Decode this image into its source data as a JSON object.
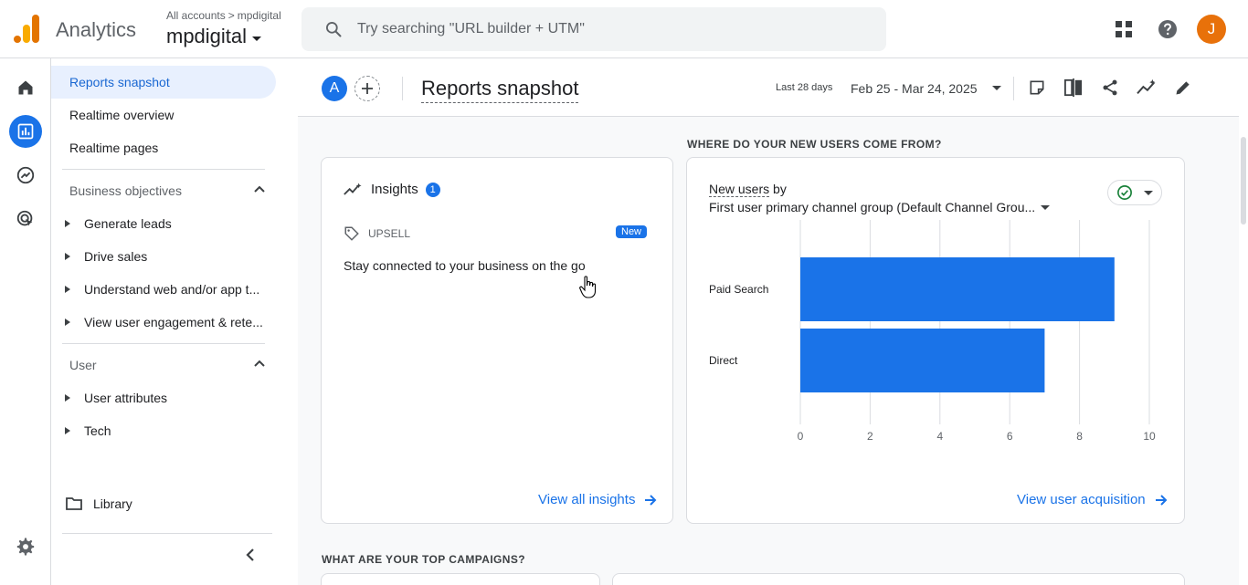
{
  "topbar": {
    "app_name": "Analytics",
    "breadcrumb_root": "All accounts",
    "breadcrumb_sep": ">",
    "breadcrumb_account": "mpdigital",
    "property_name": "mpdigital",
    "search_placeholder": "Try searching \"URL builder + UTM\"",
    "avatar_letter": "J",
    "colors": {
      "logo_dark": "#e37400",
      "logo_light": "#f9ab00",
      "avatar": "#e8710a"
    }
  },
  "rail": {
    "items": [
      {
        "icon": "home-icon",
        "active": false
      },
      {
        "icon": "reports-icon",
        "active": true
      },
      {
        "icon": "explore-icon",
        "active": false
      },
      {
        "icon": "advertising-icon",
        "active": false
      }
    ],
    "admin_icon": "gear-icon"
  },
  "nav": {
    "top_items": [
      {
        "label": "Reports snapshot",
        "active": true
      },
      {
        "label": "Realtime overview",
        "active": false
      },
      {
        "label": "Realtime pages",
        "active": false
      }
    ],
    "business_section": "Business objectives",
    "business_items": [
      {
        "label": "Generate leads"
      },
      {
        "label": "Drive sales"
      },
      {
        "label": "Understand web and/or app t..."
      },
      {
        "label": "View user engagement & rete..."
      }
    ],
    "user_section": "User",
    "user_items": [
      {
        "label": "User attributes"
      },
      {
        "label": "Tech"
      }
    ],
    "library_label": "Library"
  },
  "header": {
    "comparison_letter": "A",
    "title": "Reports snapshot",
    "date_label": "Last 28 days",
    "date_range": "Feb 25 - Mar 24, 2025",
    "icons": [
      "note-icon",
      "compare-icon",
      "share-icon",
      "insights-icon",
      "edit-icon"
    ]
  },
  "insights_card": {
    "title": "Insights",
    "count": "1",
    "tag": "UPSELL",
    "new_badge": "New",
    "text": "Stay connected to your business on the go",
    "link": "View all insights"
  },
  "acquisition": {
    "section_title": "WHERE DO YOUR NEW USERS COME FROM?",
    "metric": "New users",
    "by": "by",
    "dimension": "First user primary channel group (Default Channel Grou...",
    "link": "View user acquisition"
  },
  "campaigns": {
    "section_title": "WHAT ARE YOUR TOP CAMPAIGNS?"
  },
  "chart_data": {
    "type": "bar",
    "orientation": "horizontal",
    "categories": [
      "Paid Search",
      "Direct"
    ],
    "values": [
      9,
      7
    ],
    "xlim": [
      0,
      10
    ],
    "xticks": [
      "0",
      "2",
      "4",
      "6",
      "8",
      "10"
    ],
    "grid": true,
    "color": "#1a73e8"
  }
}
